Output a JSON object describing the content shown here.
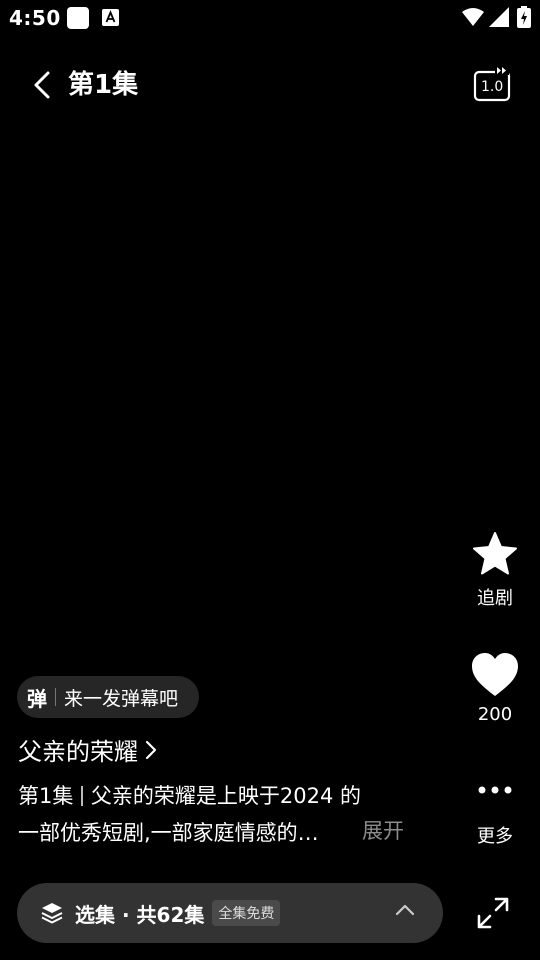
{
  "status_bar": {
    "time": "4:50"
  },
  "header": {
    "title": "第1集",
    "speed_label": "1.0"
  },
  "actions": {
    "follow_label": "追剧",
    "like_count": "200",
    "more_label": "更多"
  },
  "danmaku": {
    "icon_text": "弹",
    "placeholder": "来一发弹幕吧"
  },
  "drama": {
    "title": "父亲的荣耀",
    "episode": "第1集",
    "line1": "父亲的荣耀是上映于2024 的",
    "line2": "一部优秀短剧,一部家庭情感的…",
    "expand_label": "展开"
  },
  "episode_bar": {
    "label": "选集 · 共62集",
    "badge": "全集免费"
  }
}
